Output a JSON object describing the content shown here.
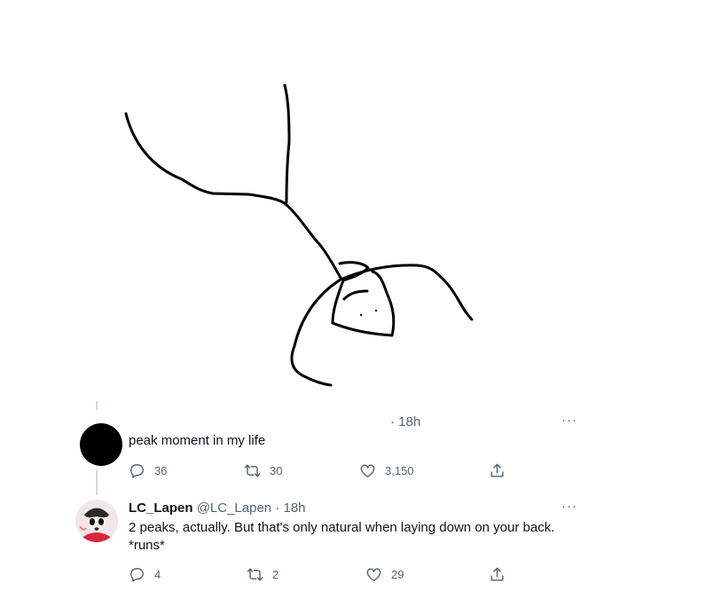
{
  "tweet1": {
    "time": "· 18h",
    "text": "peak moment in my life",
    "more_label": "···",
    "stats": {
      "replies": "36",
      "retweets": "30",
      "likes": "3,150"
    }
  },
  "tweet2": {
    "display_name": "LC_Lapen",
    "handle": "@LC_Lapen",
    "time": "· 18h",
    "more_label": "···",
    "text_line1": "2 peaks, actually. But that's only natural when laying down on your back.",
    "text_line2": "*runs*",
    "stats": {
      "replies": "4",
      "retweets": "2",
      "likes": "29"
    }
  },
  "icons": {
    "reply": "reply-icon",
    "retweet": "retweet-icon",
    "like": "heart-icon",
    "share": "share-icon"
  },
  "colors": {
    "text": "#0f1419",
    "secondary": "#536471",
    "thread_line": "#cfd9de"
  }
}
